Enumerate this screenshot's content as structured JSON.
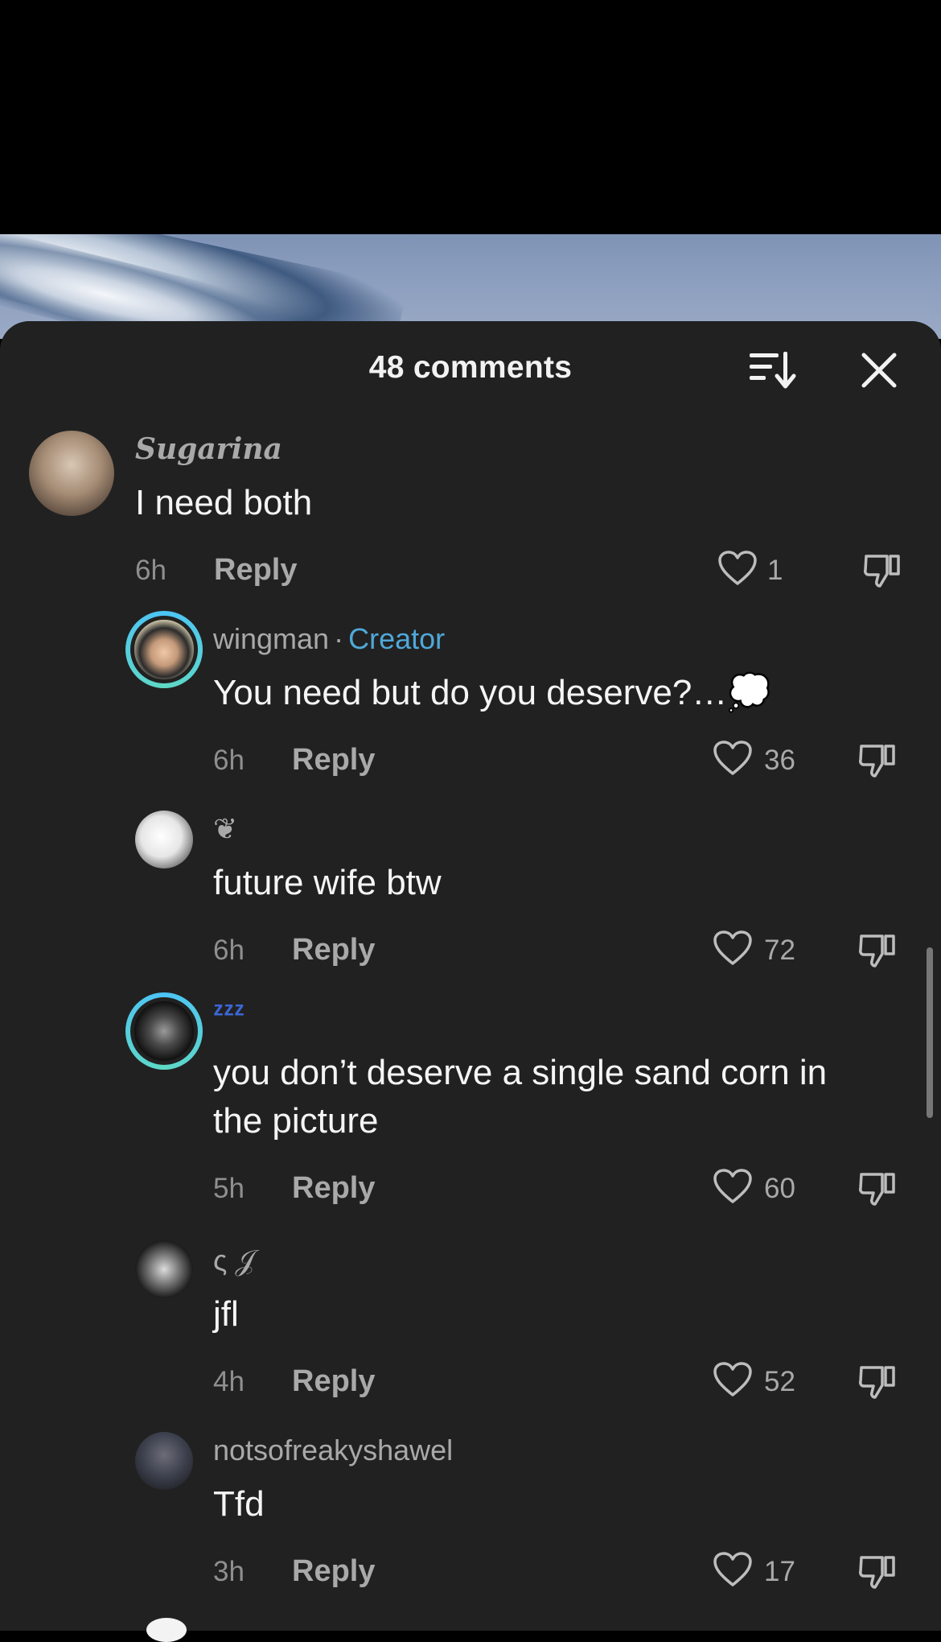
{
  "header": {
    "title": "48 comments"
  },
  "comments": [
    {
      "username": "Sugarina",
      "text": "I need both",
      "time": "6h",
      "reply": "Reply",
      "likes": "1"
    },
    {
      "username": "wingman",
      "separator": "·",
      "badge": "Creator",
      "text": "You need but do you deserve?…💭",
      "time": "6h",
      "reply": "Reply",
      "likes": "36"
    },
    {
      "username": "❦",
      "text": "future wife btw",
      "time": "6h",
      "reply": "Reply",
      "likes": "72"
    },
    {
      "username": "ᶻᶻᶻ",
      "text_line1": "you don’t deserve a single sand corn in",
      "text_line2": "the picture",
      "time": "5h",
      "reply": "Reply",
      "likes": "60"
    },
    {
      "username": "ς 𝒥",
      "text": "jfl",
      "time": "4h",
      "reply": "Reply",
      "likes": "52"
    },
    {
      "username": "notsofreakyshawel",
      "text": "Tfd",
      "time": "3h",
      "reply": "Reply",
      "likes": "17"
    }
  ],
  "icons": {
    "sort": "sort-icon",
    "close": "close-icon",
    "like": "heart-icon",
    "dislike": "dislike-icon"
  },
  "colors": {
    "sheet": "#212121",
    "creator": "#4fa8d8",
    "ring": "#4cc3f7"
  }
}
